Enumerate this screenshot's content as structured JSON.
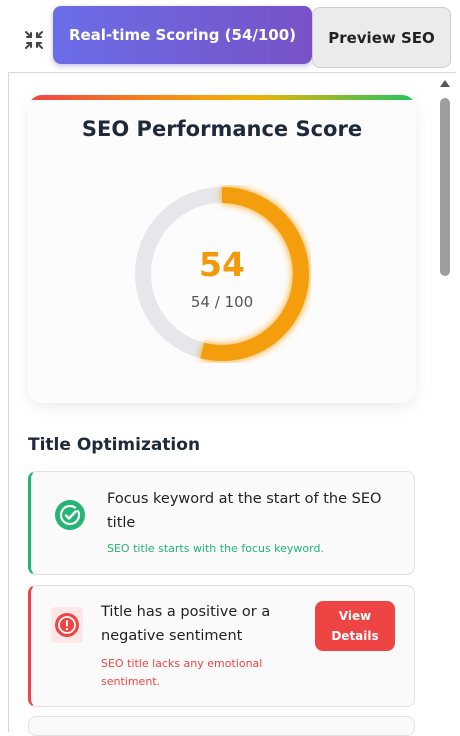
{
  "tabs": {
    "active_label": "Real-time Scoring (54/100)",
    "inactive_label": "Preview SEO"
  },
  "score": {
    "title": "SEO Performance Score",
    "value": "54",
    "fraction_text": "54 / 100",
    "progress": 0.54,
    "ring_color": "#f59e0b",
    "track_color": "#e5e7eb"
  },
  "section": {
    "title": "Title Optimization"
  },
  "checks": [
    {
      "status": "pass",
      "icon": "check-circle-icon",
      "title": "Focus keyword at the start of the SEO title",
      "description": "SEO title starts with the focus keyword.",
      "color": "#22b573"
    },
    {
      "status": "fail",
      "icon": "alert-circle-icon",
      "title": "Title has a positive or a negative sentiment",
      "description": "SEO title lacks any emotional sentiment.",
      "button_label": "View Details",
      "color": "#ef4444"
    }
  ],
  "colors": {
    "accent_gradient_start": "#6a6ee8",
    "accent_gradient_end": "#7852c6",
    "pass": "#22b573",
    "fail": "#ef4444"
  }
}
